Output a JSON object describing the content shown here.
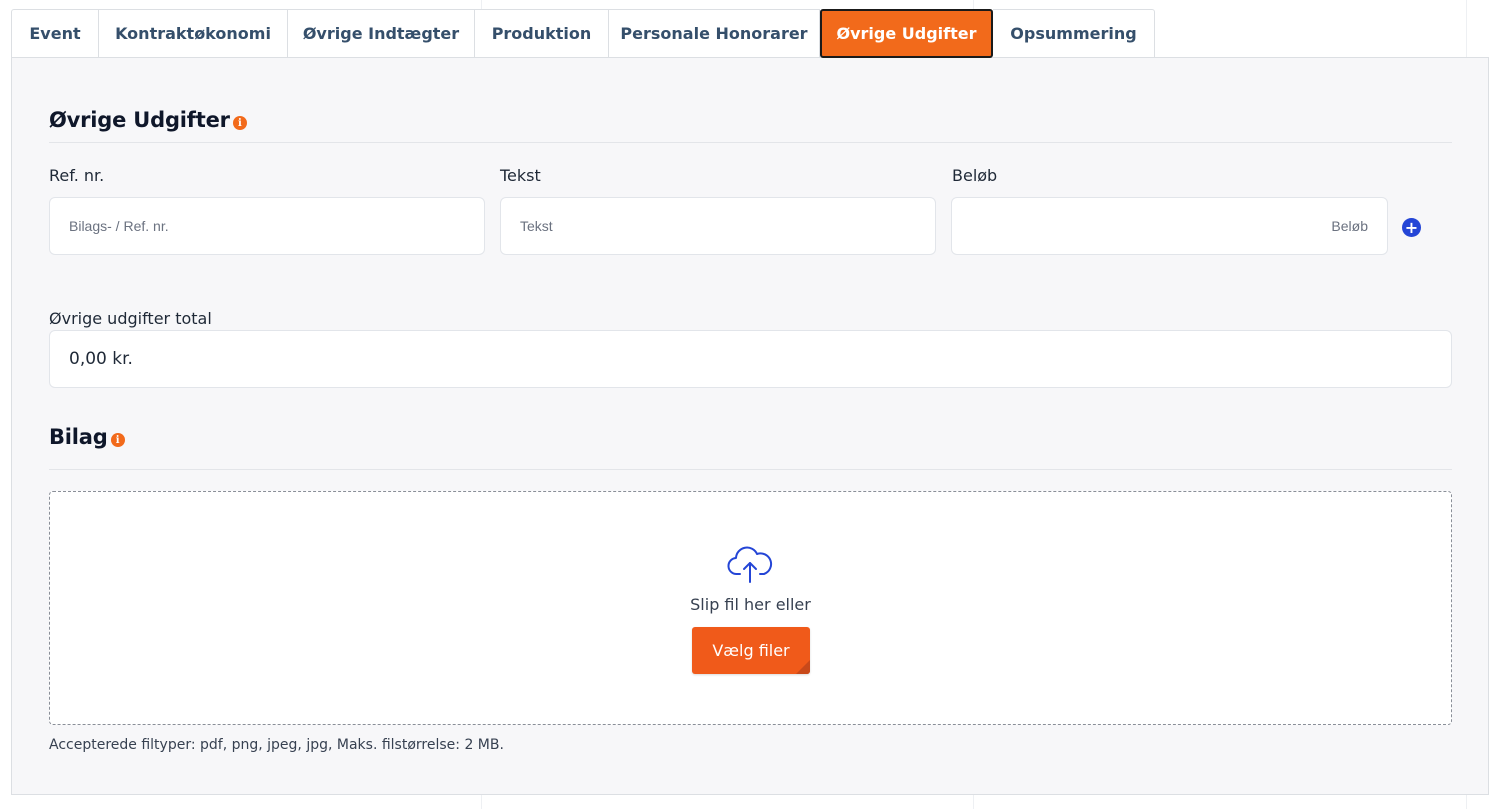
{
  "tabs": [
    {
      "label": "Event"
    },
    {
      "label": "Kontraktøkonomi"
    },
    {
      "label": "Øvrige Indtægter"
    },
    {
      "label": "Produktion"
    },
    {
      "label": "Personale Honorarer"
    },
    {
      "label": "Øvrige Udgifter",
      "active": true
    },
    {
      "label": "Opsummering"
    }
  ],
  "expenses_section": {
    "title": "Øvrige Udgifter",
    "info_icon": "info-icon",
    "ref_label": "Ref. nr.",
    "ref_placeholder": "Bilags- / Ref. nr.",
    "text_label": "Tekst",
    "text_placeholder": "Tekst",
    "amount_label": "Beløb",
    "amount_placeholder": "Beløb",
    "add_icon": "plus-circle-icon",
    "total_label": "Øvrige udgifter total",
    "total_value": "0,00 kr."
  },
  "attachments_section": {
    "title": "Bilag",
    "upload_icon": "cloud-upload-icon",
    "drop_text": "Slip fil her eller",
    "choose_button": "Vælg filer",
    "hint": "Accepterede filtyper: pdf, png, jpeg, jpg, Maks. filstørrelse: 2 MB."
  },
  "colors": {
    "accent": "#f26a1b",
    "add_button": "#2445d6",
    "tab_text": "#354f6b",
    "panel_bg": "#f7f7f9"
  }
}
